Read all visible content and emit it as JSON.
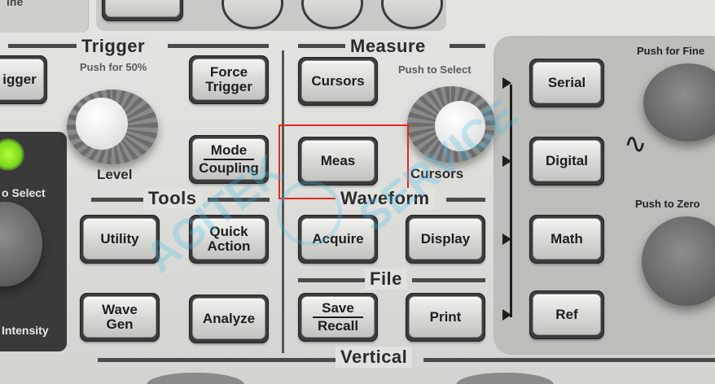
{
  "sections": {
    "trigger": "Trigger",
    "measure": "Measure",
    "tools": "Tools",
    "waveform": "Waveform",
    "file": "File",
    "vertical": "Vertical"
  },
  "sublabels": {
    "push_for_50": "Push for 50%",
    "push_to_select": "Push to Select",
    "push_for_fine": "Push for Fine",
    "push_to_zero": "Push to Zero",
    "left_select": "o Select",
    "intensity": "Intensity",
    "top_left_fragment": "ine"
  },
  "knob_labels": {
    "level": "Level",
    "cursors": "Cursors"
  },
  "buttons": {
    "trigger_partial": "igger",
    "force_trigger_1": "Force",
    "force_trigger_2": "Trigger",
    "mode_1": "Mode",
    "mode_2": "Coupling",
    "cursors": "Cursors",
    "meas": "Meas",
    "utility": "Utility",
    "quick_1": "Quick",
    "quick_2": "Action",
    "acquire": "Acquire",
    "display": "Display",
    "wave_1": "Wave",
    "wave_2": "Gen",
    "analyze": "Analyze",
    "save_1": "Save",
    "save_2": "Recall",
    "print": "Print",
    "serial": "Serial",
    "digital": "Digital",
    "math": "Math",
    "ref": "Ref"
  },
  "symbols": {
    "tilde": "∿"
  },
  "watermark": {
    "text_left": "AGITEK",
    "text_right": "SERVICE"
  },
  "colors": {
    "panel": "#d9d9d6",
    "button": "#d6d6d2",
    "highlight": "#e3281f",
    "watermark": "#46bdeb"
  }
}
